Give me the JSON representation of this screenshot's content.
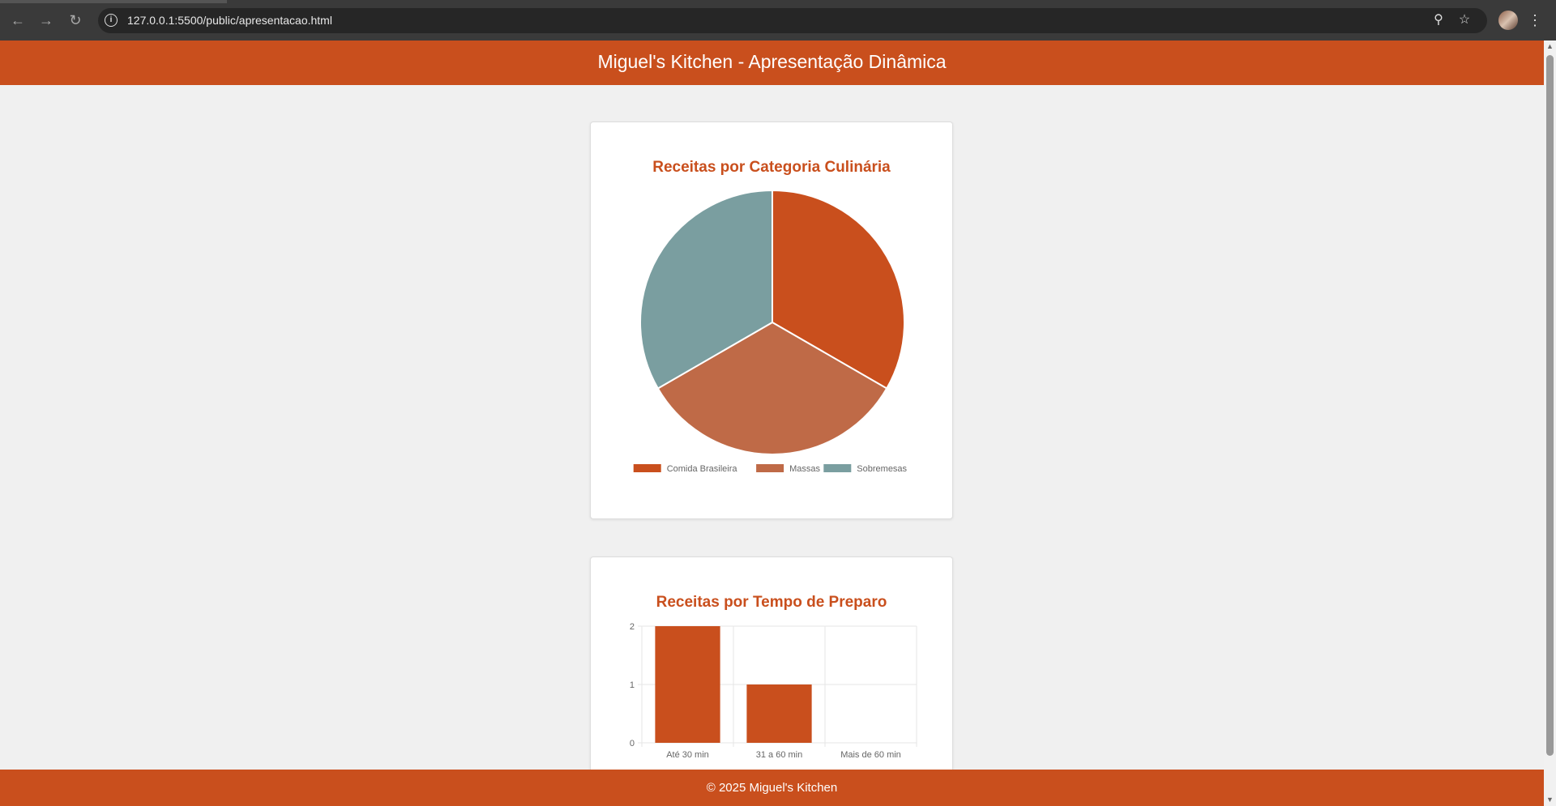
{
  "browser": {
    "url": "127.0.0.1:5500/public/apresentacao.html",
    "back_icon": "←",
    "forward_icon": "→",
    "reload_icon": "↻",
    "info_icon": "i",
    "zoom_icon": "⚲",
    "star_icon": "☆",
    "menu_icon": "⋮"
  },
  "header": {
    "title": "Miguel's Kitchen - Apresentação Dinâmica"
  },
  "footer": {
    "text": "© 2025 Miguel's Kitchen"
  },
  "colors": {
    "brand": "#c94f1d",
    "secondary": "#bf6a47",
    "teal": "#7a9ea0"
  },
  "chart_data": [
    {
      "type": "pie",
      "title": "Receitas por Categoria Culinária",
      "labels": [
        "Comida Brasileira",
        "Massas",
        "Sobremesas"
      ],
      "values": [
        1,
        1,
        1
      ],
      "colors": [
        "#c94f1d",
        "#bf6a47",
        "#7a9ea0"
      ],
      "legend": "bottom"
    },
    {
      "type": "bar",
      "title": "Receitas por Tempo de Preparo",
      "categories": [
        "Até 30 min",
        "31 a 60 min",
        "Mais de 60 min"
      ],
      "values": [
        2,
        1,
        0
      ],
      "ylim": [
        0,
        2
      ],
      "yticks": [
        "0",
        "1",
        "2"
      ],
      "color": "#c94f1d",
      "grid": true
    }
  ]
}
